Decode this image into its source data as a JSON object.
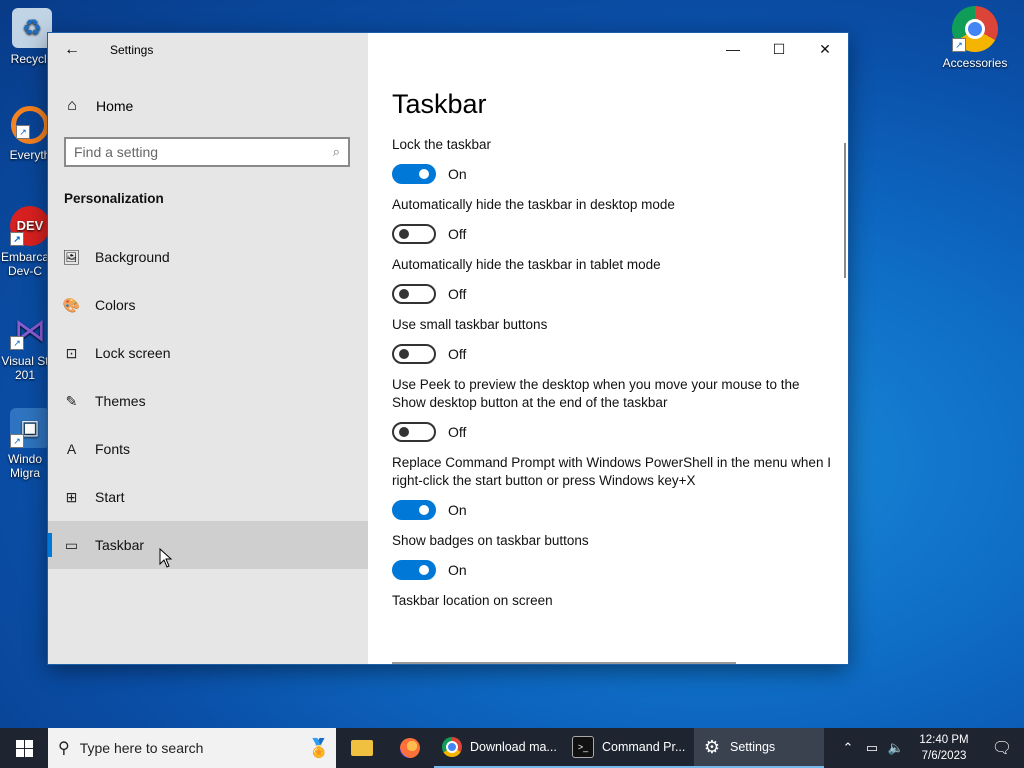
{
  "desktop": {
    "icons_left": [
      {
        "label": "Recycle",
        "color": "#c0d4e6",
        "glyph": "♻"
      },
      {
        "label": "Everyth",
        "color": "#f58220",
        "glyph": "🔍"
      },
      {
        "label": "Embarca Dev-C",
        "color": "#d92020",
        "glyph": "DEV"
      },
      {
        "label": "Visual St 201",
        "color": "#6a3fb5",
        "glyph": "⋈"
      },
      {
        "label": "Windo Migra",
        "color": "#2f74c0",
        "glyph": "▣"
      }
    ],
    "icon_right": {
      "label": "Accessories"
    }
  },
  "window": {
    "title": "Settings",
    "back_glyph": "←",
    "controls": {
      "minimize": "—",
      "maximize": "☐",
      "close": "✕"
    }
  },
  "sidebar": {
    "home_label": "Home",
    "search_placeholder": "Find a setting",
    "section_title": "Personalization",
    "items": [
      {
        "label": "Background",
        "icon": "🖼"
      },
      {
        "label": "Colors",
        "icon": "🎨"
      },
      {
        "label": "Lock screen",
        "icon": "⊡"
      },
      {
        "label": "Themes",
        "icon": "✎"
      },
      {
        "label": "Fonts",
        "icon": "A"
      },
      {
        "label": "Start",
        "icon": "⊞"
      },
      {
        "label": "Taskbar",
        "icon": "▭"
      }
    ]
  },
  "main": {
    "heading": "Taskbar",
    "settings": [
      {
        "label": "Lock the taskbar",
        "state": "On"
      },
      {
        "label": "Automatically hide the taskbar in desktop mode",
        "state": "Off"
      },
      {
        "label": "Automatically hide the taskbar in tablet mode",
        "state": "Off"
      },
      {
        "label": "Use small taskbar buttons",
        "state": "Off"
      },
      {
        "label": "Use Peek to preview the desktop when you move your mouse to the Show desktop button at the end of the taskbar",
        "state": "Off"
      },
      {
        "label": "Replace Command Prompt with Windows PowerShell in the menu when I right-click the start button or press Windows key+X",
        "state": "On"
      },
      {
        "label": "Show badges on taskbar buttons",
        "state": "On"
      }
    ],
    "location_label": "Taskbar location on screen"
  },
  "taskbar": {
    "search_placeholder": "Type here to search",
    "apps": [
      {
        "label": "Download ma...",
        "color": "#db4437"
      },
      {
        "label": "Command Pr...",
        "color": "#111111"
      },
      {
        "label": "Settings",
        "color": "#3a4250"
      }
    ],
    "time": "12:40 PM",
    "date": "7/6/2023"
  },
  "colors": {
    "accent": "#0078d7"
  }
}
